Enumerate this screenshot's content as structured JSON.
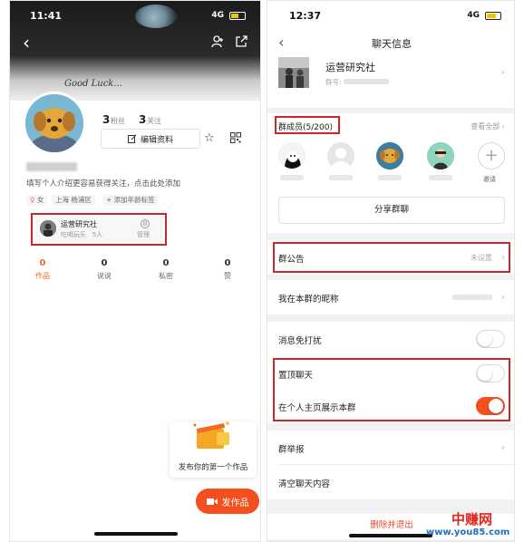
{
  "left": {
    "status": {
      "time": "11:41",
      "network": "4G"
    },
    "cover_text": "Good Luck...",
    "stats": [
      {
        "num": "3",
        "label": "粉丝"
      },
      {
        "num": "3",
        "label": "关注"
      }
    ],
    "edit_label": "编辑资料",
    "bio": "填写个人介绍更容易获得关注，点击此处添加",
    "tags": [
      "女",
      "上海 杨浦区",
      "+ 添加年龄标签"
    ],
    "group_card": {
      "name": "运营研究社",
      "category": "吃喝玩乐",
      "members": "5人",
      "manage": "管理"
    },
    "tabs": [
      {
        "num": "0",
        "label": "作品"
      },
      {
        "num": "0",
        "label": "说说"
      },
      {
        "num": "0",
        "label": "私密"
      },
      {
        "num": "0",
        "label": "赞"
      }
    ],
    "promo_text": "发布你的第一个作品",
    "publish_label": "发作品",
    "accent": "#f36a20"
  },
  "right": {
    "status": {
      "time": "12:37",
      "network": "4G"
    },
    "title": "聊天信息",
    "group_name": "运营研究社",
    "group_num_label": "群号:",
    "members_title": "群成员(5/200)",
    "view_all": "查看全部",
    "invite_label": "邀请",
    "share_label": "分享群聊",
    "notice_label": "群公告",
    "notice_value": "未设置",
    "nickname_label": "我在本群的昵称",
    "dnd_label": "消息免打扰",
    "pin_label": "置顶聊天",
    "show_label": "在个人主页展示本群",
    "report_label": "群举报",
    "clear_label": "清空聊天内容",
    "leave_label": "删除并退出",
    "toggles": {
      "dnd": false,
      "pin": false,
      "show": true
    },
    "accent": "#f34f1f"
  },
  "watermark": {
    "cn": "中赚网",
    "en": "www.you85.com"
  },
  "highlight_color": "#d2232a"
}
